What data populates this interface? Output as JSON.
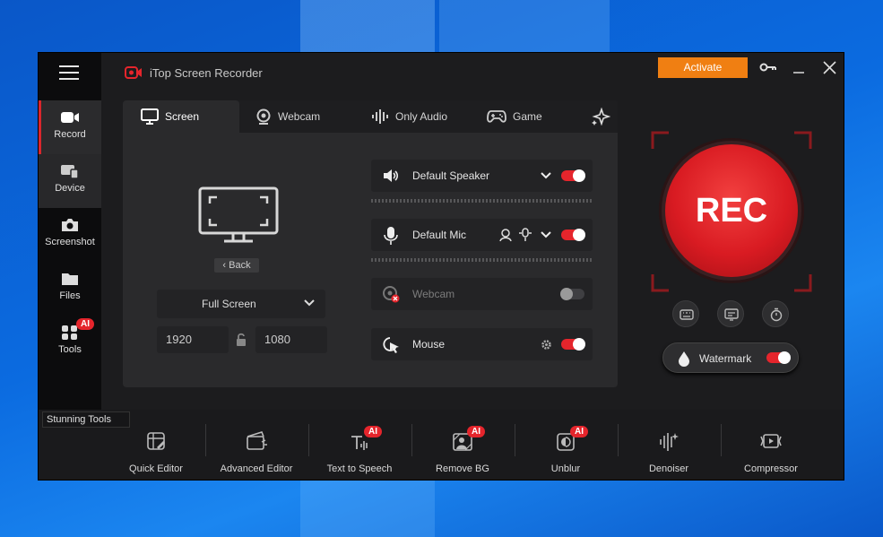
{
  "app": {
    "title": "iTop Screen Recorder",
    "activate_label": "Activate"
  },
  "sidebar": {
    "items": [
      {
        "label": "Record"
      },
      {
        "label": "Device"
      },
      {
        "label": "Screenshot"
      },
      {
        "label": "Files"
      },
      {
        "label": "Tools",
        "badge": "AI"
      }
    ]
  },
  "tabs": [
    {
      "label": "Screen"
    },
    {
      "label": "Webcam"
    },
    {
      "label": "Only Audio"
    },
    {
      "label": "Game"
    }
  ],
  "screen": {
    "back_label": "Back",
    "mode": "Full Screen",
    "width": "1920",
    "height": "1080"
  },
  "devices": {
    "speaker": {
      "label": "Default Speaker",
      "enabled": true
    },
    "mic": {
      "label": "Default Mic",
      "enabled": true
    },
    "webcam": {
      "label": "Webcam",
      "enabled": false
    },
    "mouse": {
      "label": "Mouse",
      "enabled": true
    }
  },
  "record": {
    "label": "REC"
  },
  "watermark": {
    "label": "Watermark",
    "enabled": true
  },
  "tools_panel": {
    "title": "Stunning Tools",
    "tools": [
      {
        "label": "Quick Editor",
        "badge": ""
      },
      {
        "label": "Advanced Editor",
        "badge": ""
      },
      {
        "label": "Text to Speech",
        "badge": "AI"
      },
      {
        "label": "Remove BG",
        "badge": "AI"
      },
      {
        "label": "Unblur",
        "badge": "AI"
      },
      {
        "label": "Denoiser",
        "badge": ""
      },
      {
        "label": "Compressor",
        "badge": ""
      }
    ]
  },
  "colors": {
    "accent": "#e5252c",
    "activate": "#f07f12",
    "window": "#1c1c1e"
  },
  "icons": [
    "menu-icon",
    "key-icon",
    "minimize-icon",
    "close-icon",
    "monitor-icon",
    "webcam-icon",
    "waveform-icon",
    "gamepad-icon",
    "sparkle-icon",
    "speaker-icon",
    "mic-icon",
    "lock-icon",
    "gear-icon"
  ]
}
